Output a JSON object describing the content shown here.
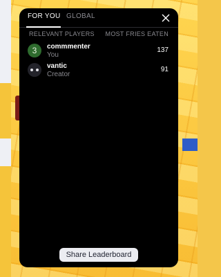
{
  "tabs": [
    {
      "label": "FOR YOU",
      "active": true
    },
    {
      "label": "GLOBAL",
      "active": false
    }
  ],
  "columns": {
    "players": "RELEVANT PLAYERS",
    "metric": "MOST FRIES EATEN"
  },
  "rows": [
    {
      "name": "commmenter",
      "subtitle": "You",
      "score": "137",
      "avatar": "3",
      "avatar_color": "#2e6b2e"
    },
    {
      "name": "vantic",
      "subtitle": "Creator",
      "score": "91",
      "avatar_icon": "face-icon",
      "avatar_color": "#23232a"
    }
  ],
  "share_label": "Share Leaderboard",
  "colors": {
    "panel_bg": "#000000",
    "muted_text": "#8a8a90",
    "button_bg": "#ecedf2"
  }
}
